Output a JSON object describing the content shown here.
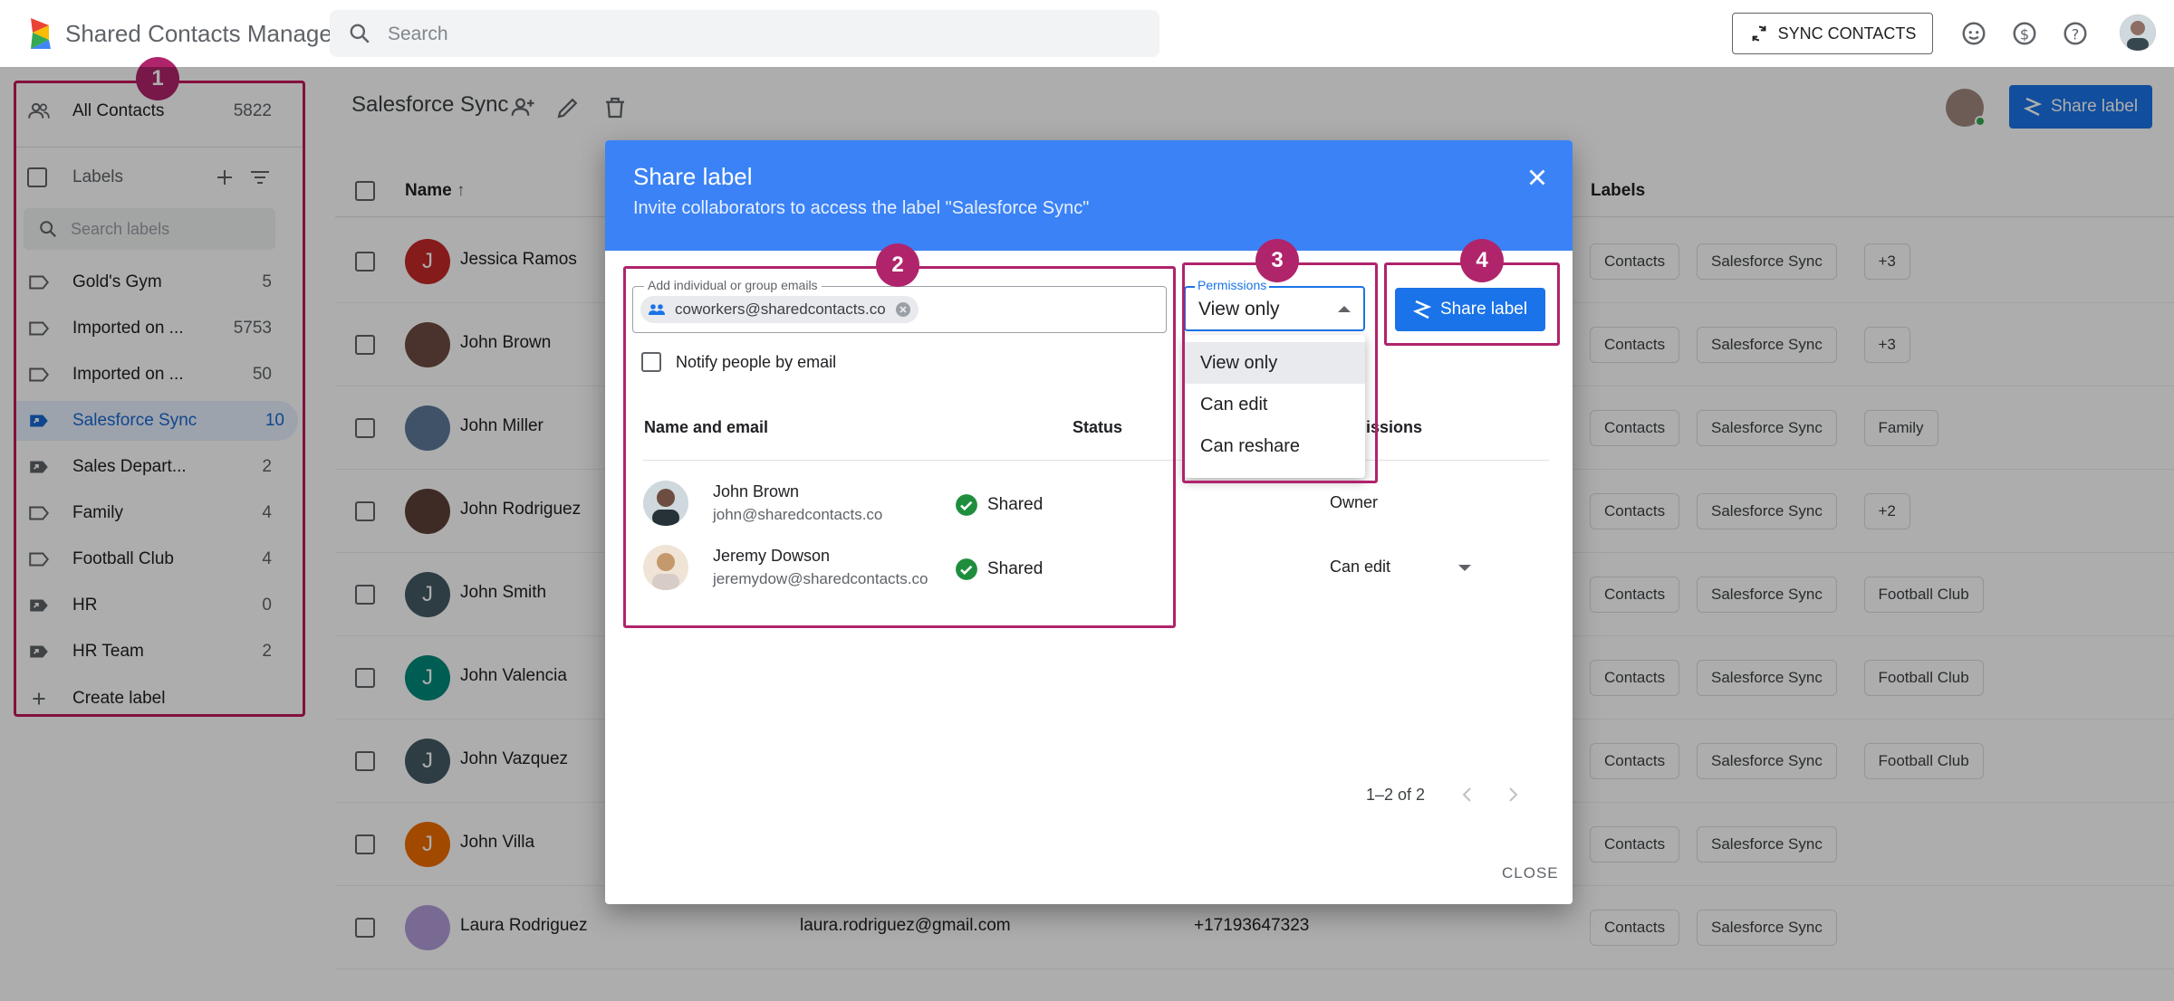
{
  "header": {
    "app_title": "Shared Contacts Manager",
    "search_placeholder": "Search",
    "sync_label": "SYNC CONTACTS"
  },
  "sidebar": {
    "all_contacts": {
      "label": "All Contacts",
      "count": "5822"
    },
    "labels_heading": "Labels",
    "search_placeholder": "Search labels",
    "items": [
      {
        "label": "Gold's Gym",
        "count": "5",
        "icon": "label-outline-icon"
      },
      {
        "label": "Imported on ...",
        "count": "5753",
        "icon": "label-outline-icon"
      },
      {
        "label": "Imported on ...",
        "count": "50",
        "icon": "label-outline-icon"
      },
      {
        "label": "Salesforce Sync",
        "count": "10",
        "icon": "shared-label-icon",
        "active": true
      },
      {
        "label": "Sales Depart...",
        "count": "2",
        "icon": "shared-label-icon"
      },
      {
        "label": "Family",
        "count": "4",
        "icon": "label-outline-icon"
      },
      {
        "label": "Football Club",
        "count": "4",
        "icon": "label-outline-icon"
      },
      {
        "label": "HR",
        "count": "0",
        "icon": "shared-label-icon"
      },
      {
        "label": "HR Team",
        "count": "2",
        "icon": "shared-label-icon"
      }
    ],
    "create_label": "Create label"
  },
  "badges": {
    "one": "1",
    "two": "2",
    "three": "3",
    "four": "4"
  },
  "toolbar": {
    "page_title": "Salesforce Sync",
    "share_label": "Share label"
  },
  "table": {
    "col_name": "Name",
    "col_labels": "Labels",
    "rows": [
      {
        "name": "Jessica Ramos",
        "initial": "J",
        "avatar_color": "#c62828",
        "email": "",
        "phone": "",
        "chips": [
          "Contacts",
          "Salesforce Sync",
          "+3"
        ]
      },
      {
        "name": "John Brown",
        "initial": "",
        "avatar_color": "#6d4c41",
        "email": "",
        "phone": "",
        "chips": [
          "Contacts",
          "Salesforce Sync",
          "+3"
        ]
      },
      {
        "name": "John Miller",
        "initial": "",
        "avatar_color": "#5d7a9a",
        "email": "",
        "phone": "",
        "chips": [
          "Contacts",
          "Salesforce Sync",
          "Family"
        ]
      },
      {
        "name": "John Rodriguez",
        "initial": "",
        "avatar_color": "#5d4037",
        "email": "",
        "phone": "",
        "chips": [
          "Contacts",
          "Salesforce Sync",
          "+2"
        ]
      },
      {
        "name": "John Smith",
        "initial": "J",
        "avatar_color": "#455a64",
        "email": "",
        "phone": "",
        "chips": [
          "Contacts",
          "Salesforce Sync",
          "Football Club"
        ]
      },
      {
        "name": "John Valencia",
        "initial": "J",
        "avatar_color": "#00897b",
        "email": "",
        "phone": "",
        "chips": [
          "Contacts",
          "Salesforce Sync",
          "Football Club"
        ]
      },
      {
        "name": "John Vazquez",
        "initial": "J",
        "avatar_color": "#455a64",
        "email": "",
        "phone": "",
        "chips": [
          "Contacts",
          "Salesforce Sync",
          "Football Club"
        ]
      },
      {
        "name": "John Villa",
        "initial": "J",
        "avatar_color": "#ef6c00",
        "email": "",
        "phone": "",
        "chips": [
          "Contacts",
          "Salesforce Sync"
        ]
      },
      {
        "name": "Laura Rodriguez",
        "initial": "",
        "avatar_color": "#b39ddb",
        "email": "laura.rodriguez@gmail.com",
        "phone": "+17193647323",
        "chips": [
          "Contacts",
          "Salesforce Sync"
        ]
      }
    ]
  },
  "dialog": {
    "title": "Share label",
    "subtitle": "Invite collaborators to access the label \"Salesforce Sync\"",
    "email_field_label": "Add individual or group emails",
    "email_chip": "coworkers@sharedcontacts.co",
    "notify_label": "Notify people by email",
    "col_name_email": "Name and email",
    "col_status": "Status",
    "col_permissions": "issions",
    "people": [
      {
        "name": "John Brown",
        "email": "john@sharedcontacts.co",
        "status": "Shared",
        "permission": "Owner"
      },
      {
        "name": "Jeremy Dowson",
        "email": "jeremydow@sharedcontacts.co",
        "status": "Shared",
        "permission": "Can edit"
      }
    ],
    "permissions_label": "Permissions",
    "permissions_value": "View only",
    "permission_options": [
      "View only",
      "Can edit",
      "Can reshare"
    ],
    "share_button": "Share label",
    "pagination": "1–2 of 2",
    "close_button": "CLOSE"
  },
  "colors": {
    "primary": "#1a73e8",
    "dialog_header": "#3b82f6",
    "highlight_border": "#b0246b",
    "shared_green": "#1e8e3e"
  }
}
